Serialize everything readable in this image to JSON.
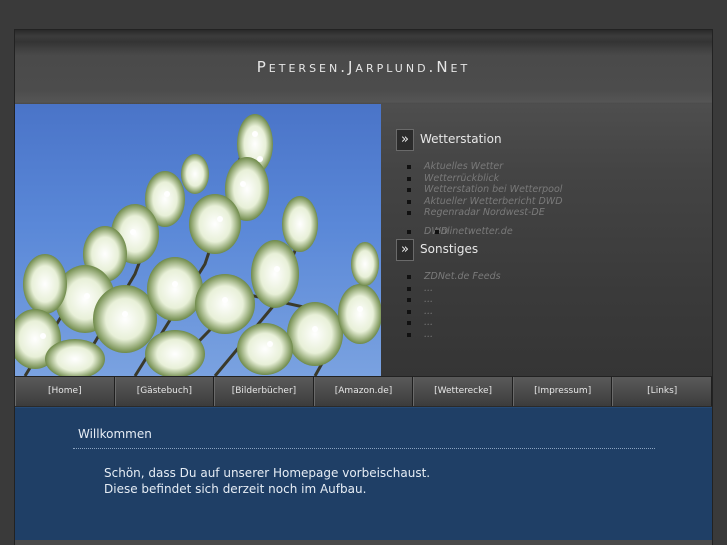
{
  "site": {
    "title": "Petersen.Jarplund.Net"
  },
  "sidebar": {
    "sections": [
      {
        "title": "Wetterstation",
        "links": [
          "Aktuelles Wetter",
          "Wetterrückblick",
          "Wetterstation bei Wetterpool",
          "Aktueller Wetterbericht DWD",
          "Regenradar Nordwest-DE",
          "DWD",
          "onlinetwetter.de"
        ]
      },
      {
        "title": "Sonstiges",
        "links": [
          "ZDNet.de Feeds",
          "...",
          "...",
          "...",
          "...",
          "..."
        ]
      }
    ]
  },
  "nav": {
    "items": [
      "[Home]",
      "[Gästebuch]",
      "[Bilderbücher]",
      "[Amazon.de]",
      "[Wetterecke]",
      "[Impressum]",
      "[Links]"
    ]
  },
  "content": {
    "heading": "Willkommen",
    "line1": "Schön, dass Du auf unserer Homepage vorbeischaust.",
    "line2": "Diese befindet sich derzeit noch im Aufbau."
  }
}
